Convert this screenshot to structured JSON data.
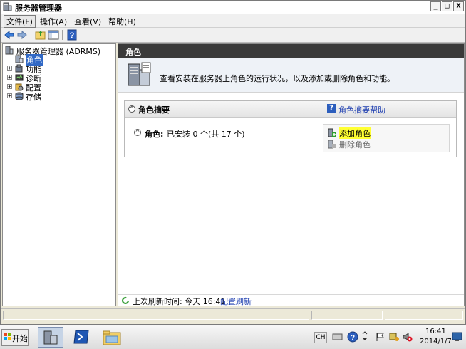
{
  "window": {
    "title": "服务器管理器",
    "controls": {
      "minimize": "_",
      "maximize": "□",
      "close": "X"
    }
  },
  "menubar": {
    "items": [
      "文件(F)",
      "操作(A)",
      "查看(V)",
      "帮助(H)"
    ]
  },
  "tree": {
    "root": "服务器管理器 (ADRMS)",
    "items": [
      {
        "label": "角色",
        "selected": true,
        "expandable": false
      },
      {
        "label": "功能",
        "selected": false,
        "expandable": true
      },
      {
        "label": "诊断",
        "selected": false,
        "expandable": true
      },
      {
        "label": "配置",
        "selected": false,
        "expandable": true
      },
      {
        "label": "存储",
        "selected": false,
        "expandable": true
      }
    ]
  },
  "content": {
    "header": "角色",
    "intro": "查看安装在服务器上角色的运行状况，以及添加或删除角色和功能。",
    "summary": {
      "title": "角色摘要",
      "help_link": "角色摘要帮助",
      "roles_label": "角色:",
      "roles_status": "已安装 0 个(共 17 个)",
      "actions": {
        "add": "添加角色",
        "remove": "删除角色"
      }
    },
    "refresh": {
      "label": "上次刷新时间: 今天 16:41",
      "link": "配置刷新"
    }
  },
  "taskbar": {
    "start": "开始",
    "lang": "CH",
    "time": "16:41",
    "date": "2014/1/7"
  },
  "colors": {
    "header_bg": "#3a3a3a",
    "link": "#1f3fb0",
    "highlight": "#ffff33",
    "selection": "#3169c6"
  }
}
